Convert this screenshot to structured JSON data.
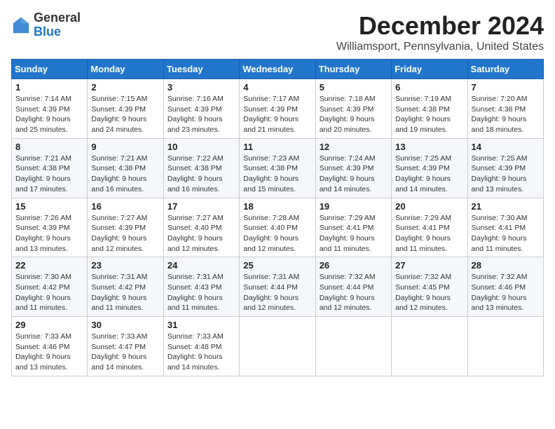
{
  "header": {
    "logo_general": "General",
    "logo_blue": "Blue",
    "month_title": "December 2024",
    "location": "Williamsport, Pennsylvania, United States"
  },
  "days_of_week": [
    "Sunday",
    "Monday",
    "Tuesday",
    "Wednesday",
    "Thursday",
    "Friday",
    "Saturday"
  ],
  "weeks": [
    [
      {
        "day": "1",
        "sunrise": "7:14 AM",
        "sunset": "4:39 PM",
        "daylight": "9 hours and 25 minutes."
      },
      {
        "day": "2",
        "sunrise": "7:15 AM",
        "sunset": "4:39 PM",
        "daylight": "9 hours and 24 minutes."
      },
      {
        "day": "3",
        "sunrise": "7:16 AM",
        "sunset": "4:39 PM",
        "daylight": "9 hours and 23 minutes."
      },
      {
        "day": "4",
        "sunrise": "7:17 AM",
        "sunset": "4:39 PM",
        "daylight": "9 hours and 21 minutes."
      },
      {
        "day": "5",
        "sunrise": "7:18 AM",
        "sunset": "4:39 PM",
        "daylight": "9 hours and 20 minutes."
      },
      {
        "day": "6",
        "sunrise": "7:19 AM",
        "sunset": "4:38 PM",
        "daylight": "9 hours and 19 minutes."
      },
      {
        "day": "7",
        "sunrise": "7:20 AM",
        "sunset": "4:38 PM",
        "daylight": "9 hours and 18 minutes."
      }
    ],
    [
      {
        "day": "8",
        "sunrise": "7:21 AM",
        "sunset": "4:38 PM",
        "daylight": "9 hours and 17 minutes."
      },
      {
        "day": "9",
        "sunrise": "7:21 AM",
        "sunset": "4:38 PM",
        "daylight": "9 hours and 16 minutes."
      },
      {
        "day": "10",
        "sunrise": "7:22 AM",
        "sunset": "4:38 PM",
        "daylight": "9 hours and 16 minutes."
      },
      {
        "day": "11",
        "sunrise": "7:23 AM",
        "sunset": "4:38 PM",
        "daylight": "9 hours and 15 minutes."
      },
      {
        "day": "12",
        "sunrise": "7:24 AM",
        "sunset": "4:39 PM",
        "daylight": "9 hours and 14 minutes."
      },
      {
        "day": "13",
        "sunrise": "7:25 AM",
        "sunset": "4:39 PM",
        "daylight": "9 hours and 14 minutes."
      },
      {
        "day": "14",
        "sunrise": "7:25 AM",
        "sunset": "4:39 PM",
        "daylight": "9 hours and 13 minutes."
      }
    ],
    [
      {
        "day": "15",
        "sunrise": "7:26 AM",
        "sunset": "4:39 PM",
        "daylight": "9 hours and 13 minutes."
      },
      {
        "day": "16",
        "sunrise": "7:27 AM",
        "sunset": "4:39 PM",
        "daylight": "9 hours and 12 minutes."
      },
      {
        "day": "17",
        "sunrise": "7:27 AM",
        "sunset": "4:40 PM",
        "daylight": "9 hours and 12 minutes."
      },
      {
        "day": "18",
        "sunrise": "7:28 AM",
        "sunset": "4:40 PM",
        "daylight": "9 hours and 12 minutes."
      },
      {
        "day": "19",
        "sunrise": "7:29 AM",
        "sunset": "4:41 PM",
        "daylight": "9 hours and 11 minutes."
      },
      {
        "day": "20",
        "sunrise": "7:29 AM",
        "sunset": "4:41 PM",
        "daylight": "9 hours and 11 minutes."
      },
      {
        "day": "21",
        "sunrise": "7:30 AM",
        "sunset": "4:41 PM",
        "daylight": "9 hours and 11 minutes."
      }
    ],
    [
      {
        "day": "22",
        "sunrise": "7:30 AM",
        "sunset": "4:42 PM",
        "daylight": "9 hours and 11 minutes."
      },
      {
        "day": "23",
        "sunrise": "7:31 AM",
        "sunset": "4:42 PM",
        "daylight": "9 hours and 11 minutes."
      },
      {
        "day": "24",
        "sunrise": "7:31 AM",
        "sunset": "4:43 PM",
        "daylight": "9 hours and 11 minutes."
      },
      {
        "day": "25",
        "sunrise": "7:31 AM",
        "sunset": "4:44 PM",
        "daylight": "9 hours and 12 minutes."
      },
      {
        "day": "26",
        "sunrise": "7:32 AM",
        "sunset": "4:44 PM",
        "daylight": "9 hours and 12 minutes."
      },
      {
        "day": "27",
        "sunrise": "7:32 AM",
        "sunset": "4:45 PM",
        "daylight": "9 hours and 12 minutes."
      },
      {
        "day": "28",
        "sunrise": "7:32 AM",
        "sunset": "4:46 PM",
        "daylight": "9 hours and 13 minutes."
      }
    ],
    [
      {
        "day": "29",
        "sunrise": "7:33 AM",
        "sunset": "4:46 PM",
        "daylight": "9 hours and 13 minutes."
      },
      {
        "day": "30",
        "sunrise": "7:33 AM",
        "sunset": "4:47 PM",
        "daylight": "9 hours and 14 minutes."
      },
      {
        "day": "31",
        "sunrise": "7:33 AM",
        "sunset": "4:48 PM",
        "daylight": "9 hours and 14 minutes."
      },
      null,
      null,
      null,
      null
    ]
  ],
  "labels": {
    "sunrise": "Sunrise:",
    "sunset": "Sunset:",
    "daylight": "Daylight:"
  }
}
